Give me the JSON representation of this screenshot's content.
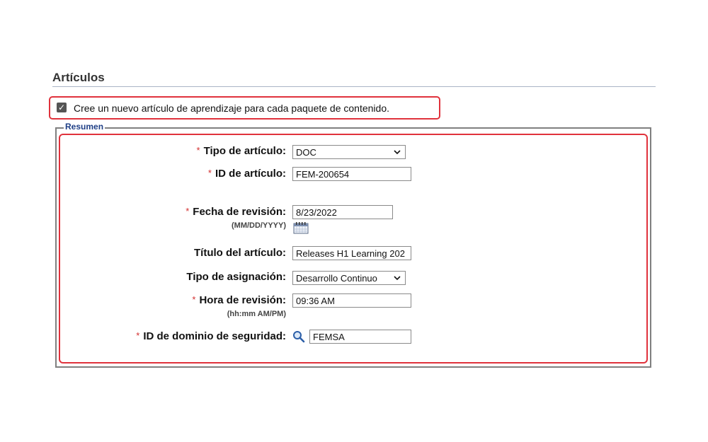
{
  "section": {
    "title": "Artículos"
  },
  "create_item": {
    "checked": true,
    "label": "Cree un nuevo artículo de aprendizaje para cada paquete de contenido."
  },
  "summary": {
    "legend": "Resumen",
    "fields": {
      "item_type": {
        "required": "*",
        "label": "Tipo de artículo:",
        "value": "DOC"
      },
      "item_id": {
        "required": "*",
        "label": "ID de artículo:",
        "value": "FEM-200654"
      },
      "revision_date": {
        "required": "*",
        "label": "Fecha de revisión:",
        "hint": "(MM/DD/YYYY)",
        "value": "8/23/2022"
      },
      "item_title": {
        "label": "Título del artículo:",
        "value": "Releases H1 Learning 202"
      },
      "assignment_type": {
        "label": "Tipo de asignación:",
        "value": "Desarrollo Continuo"
      },
      "revision_time": {
        "required": "*",
        "label": "Hora de revisión:",
        "hint": "(hh:mm AM/PM)",
        "value": "09:36 AM"
      },
      "security_domain": {
        "required": "*",
        "label": "ID de dominio de seguridad:",
        "value": "FEMSA"
      }
    }
  },
  "colors": {
    "highlight": "#e0323c",
    "legend": "#1f3f86",
    "required": "#d32f2f"
  }
}
